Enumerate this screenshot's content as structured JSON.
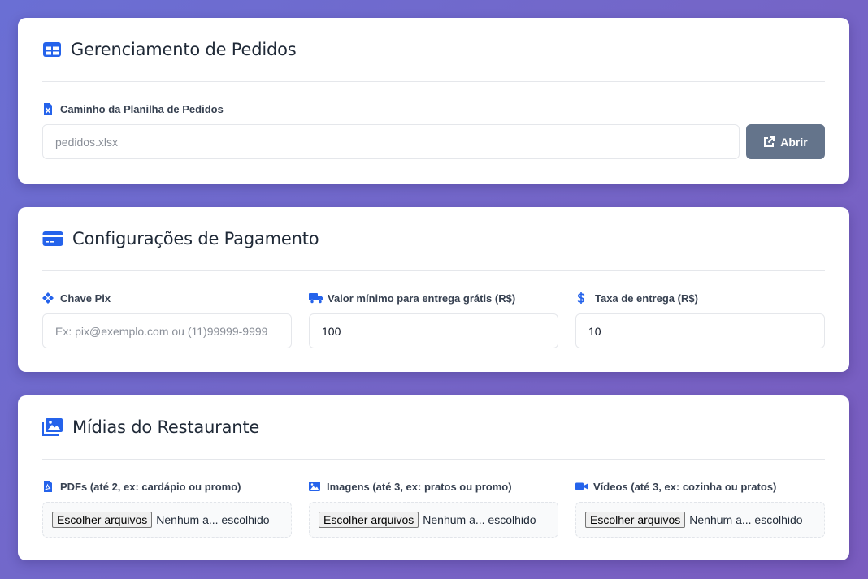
{
  "colors": {
    "accent": "#2563eb",
    "button_gray": "#64748b",
    "background_from": "#6a6fd4",
    "background_to": "#7a5cbf"
  },
  "orders": {
    "title": "Gerenciamento de Pedidos",
    "icon": "table-icon",
    "spreadsheet_label": "Caminho da Planilha de Pedidos",
    "spreadsheet_icon": "excel-file-icon",
    "spreadsheet_placeholder": "pedidos.xlsx",
    "spreadsheet_value": "",
    "open_button": "Abrir",
    "open_icon": "external-link-icon"
  },
  "payment": {
    "title": "Configurações de Pagamento",
    "icon": "credit-card-icon",
    "pix_label": "Chave Pix",
    "pix_icon": "pix-icon",
    "pix_placeholder": "Ex: pix@exemplo.com ou (11)99999-9999",
    "pix_value": "",
    "min_free_label": "Valor mínimo para entrega grátis (R$)",
    "min_free_icon": "truck-icon",
    "min_free_value": "100",
    "fee_label": "Taxa de entrega (R$)",
    "fee_icon": "dollar-icon",
    "fee_value": "10"
  },
  "media": {
    "title": "Mídias do Restaurante",
    "icon": "images-icon",
    "pdfs_label": "PDFs (até 2, ex: cardápio ou promo)",
    "pdfs_icon": "pdf-file-icon",
    "images_label": "Imagens (até 3, ex: pratos ou promo)",
    "images_icon": "image-icon",
    "videos_label": "Vídeos (até 3, ex: cozinha ou pratos)",
    "videos_icon": "video-icon",
    "choose_button": "Escolher arquivos",
    "no_file_text": "Nenhum a... escolhido"
  }
}
